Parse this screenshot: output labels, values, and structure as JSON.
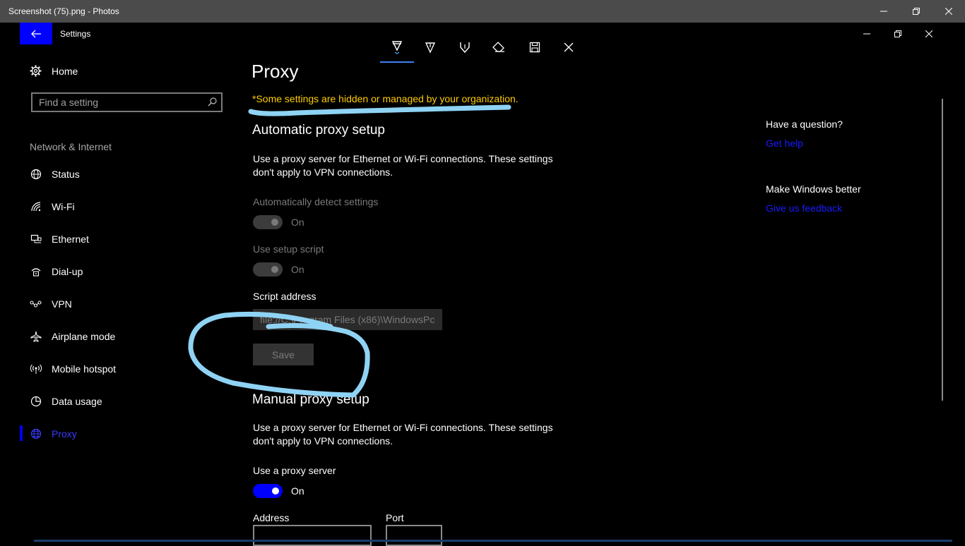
{
  "window": {
    "title": "Screenshot (75).png - Photos"
  },
  "app": {
    "title": "Settings"
  },
  "toolbar": {
    "tools": [
      "ballpoint-pen-icon",
      "pencil-icon",
      "highlighter-icon",
      "eraser-icon",
      "save-icon",
      "close-icon"
    ]
  },
  "sidebar": {
    "home": "Home",
    "search_placeholder": "Find a setting",
    "section": "Network & Internet",
    "items": [
      {
        "label": "Status",
        "icon": "globe-status-icon"
      },
      {
        "label": "Wi-Fi",
        "icon": "wifi-icon"
      },
      {
        "label": "Ethernet",
        "icon": "ethernet-icon"
      },
      {
        "label": "Dial-up",
        "icon": "dialup-icon"
      },
      {
        "label": "VPN",
        "icon": "vpn-icon"
      },
      {
        "label": "Airplane mode",
        "icon": "airplane-icon"
      },
      {
        "label": "Mobile hotspot",
        "icon": "hotspot-icon"
      },
      {
        "label": "Data usage",
        "icon": "data-usage-icon"
      },
      {
        "label": "Proxy",
        "icon": "globe-icon",
        "active": true
      }
    ]
  },
  "main": {
    "title": "Proxy",
    "org_note": "*Some settings are hidden or managed by your organization.",
    "auto": {
      "heading": "Automatic proxy setup",
      "description": "Use a proxy server for Ethernet or Wi-Fi connections. These settings don't apply to VPN connections.",
      "detect_label": "Automatically detect settings",
      "detect_state": "On",
      "script_label": "Use setup script",
      "script_state": "On",
      "address_label": "Script address",
      "address_value": "file://C:\\Program Files (x86)\\WindowsPc",
      "save_label": "Save"
    },
    "manual": {
      "heading": "Manual proxy setup",
      "description": "Use a proxy server for Ethernet or Wi-Fi connections. These settings don't apply to VPN connections.",
      "use_label": "Use a proxy server",
      "use_state": "On",
      "address_label": "Address",
      "port_label": "Port"
    }
  },
  "aside": {
    "question": "Have a question?",
    "help_link": "Get help",
    "better": "Make Windows better",
    "feedback_link": "Give us feedback"
  },
  "colors": {
    "accent": "#0000ff",
    "warning": "#ffcc00",
    "ink": "#8fd3f4"
  }
}
